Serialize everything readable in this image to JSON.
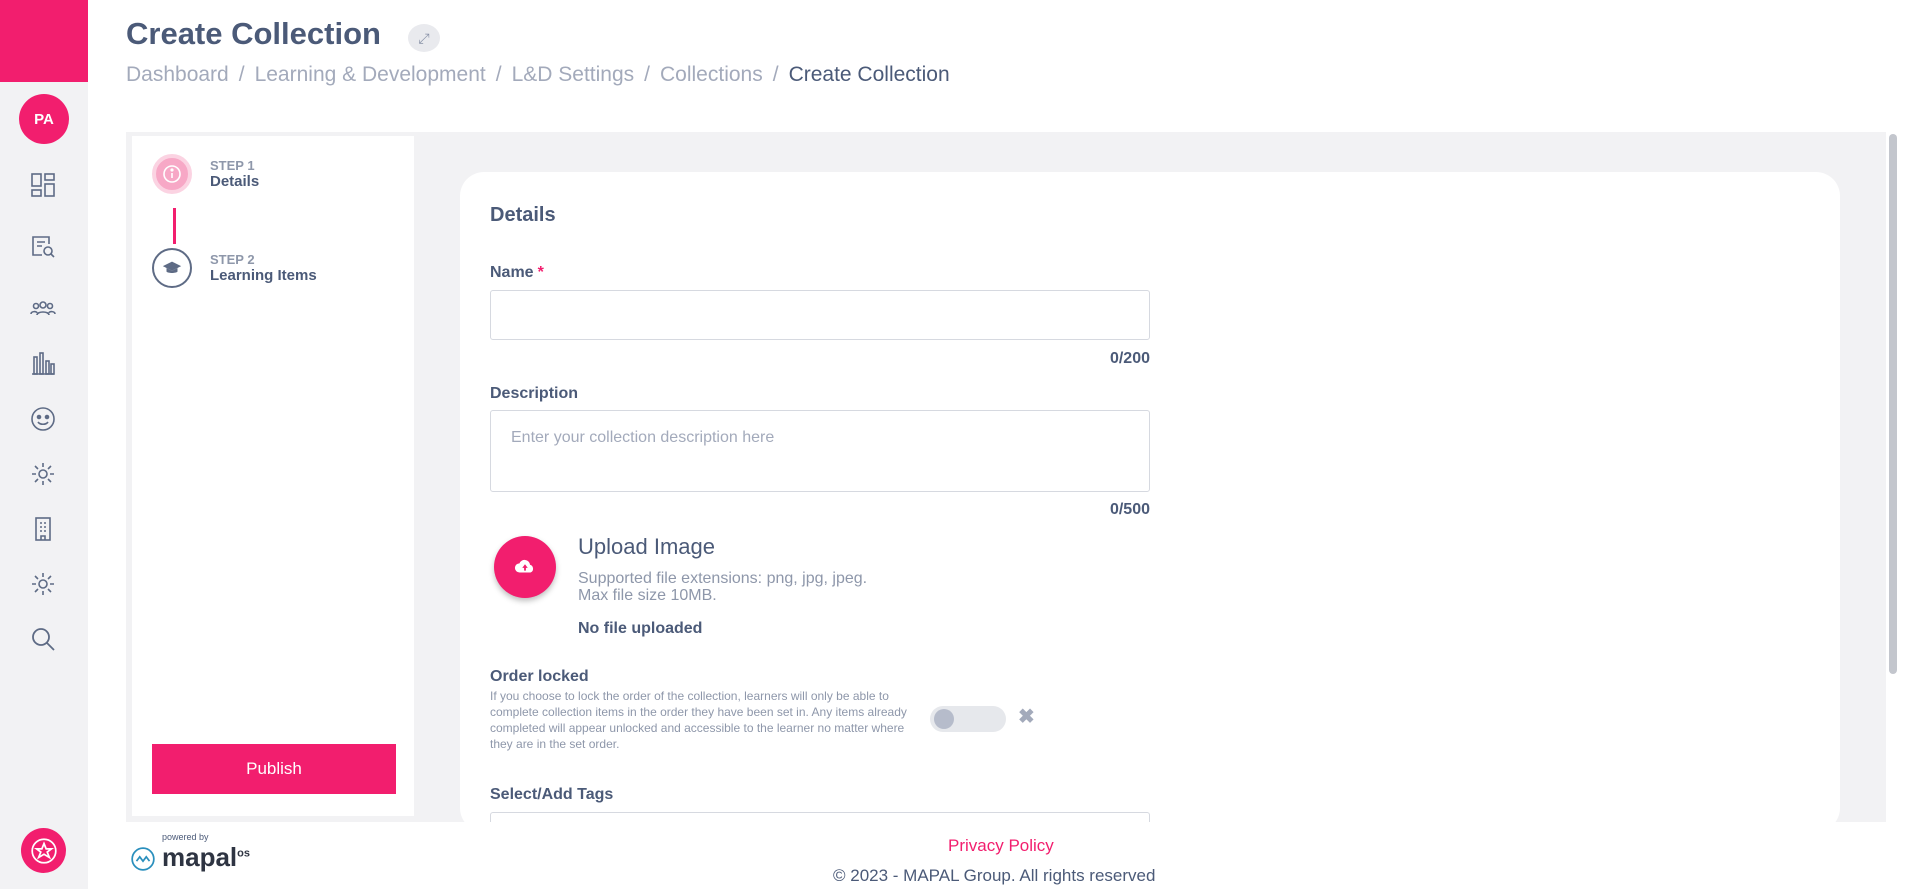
{
  "sidebar": {
    "avatar_initials": "PA",
    "nav_icons": [
      "dashboard-icon",
      "search-document-icon",
      "people-icon",
      "bar-chart-icon",
      "smiley-icon",
      "gear-icon",
      "building-icon",
      "settings-cog-icon",
      "search-icon"
    ],
    "bottom_badge_icon": "star-badge-icon"
  },
  "header": {
    "title": "Create Collection",
    "expand_icon": "expand-arrows-icon",
    "breadcrumb": [
      "Dashboard",
      "Learning & Development",
      "L&D Settings",
      "Collections",
      "Create Collection"
    ]
  },
  "steps": [
    {
      "number": "STEP 1",
      "label": "Details",
      "icon": "info-icon"
    },
    {
      "number": "STEP 2",
      "label": "Learning Items",
      "icon": "graduation-cap-icon"
    }
  ],
  "publish_label": "Publish",
  "form": {
    "section_title": "Details",
    "name_label": "Name",
    "name_required_mark": "*",
    "name_value": "",
    "name_counter": "0/200",
    "description_label": "Description",
    "description_placeholder": "Enter your collection description here",
    "description_counter": "0/500",
    "upload_title": "Upload Image",
    "upload_help_line1": "Supported file extensions: png, jpg, jpeg.",
    "upload_help_line2": "Max file size 10MB.",
    "no_file": "No file uploaded",
    "order_label": "Order locked",
    "order_description": "If you choose to lock the order of the collection, learners will only be able to complete collection items in the order they have been set in. Any items already completed will appear unlocked and accessible to the learner no matter where they are in the set order.",
    "order_locked": false,
    "tags_label": "Select/Add Tags"
  },
  "footer": {
    "powered_by": "powered by",
    "brand": "mapal",
    "brand_suffix": "os",
    "privacy": "Privacy Policy",
    "copyright": "© 2023 - MAPAL Group. All rights reserved"
  },
  "colors": {
    "accent": "#f21e6e",
    "text": "#4b5a78",
    "muted": "#a3aabb"
  }
}
